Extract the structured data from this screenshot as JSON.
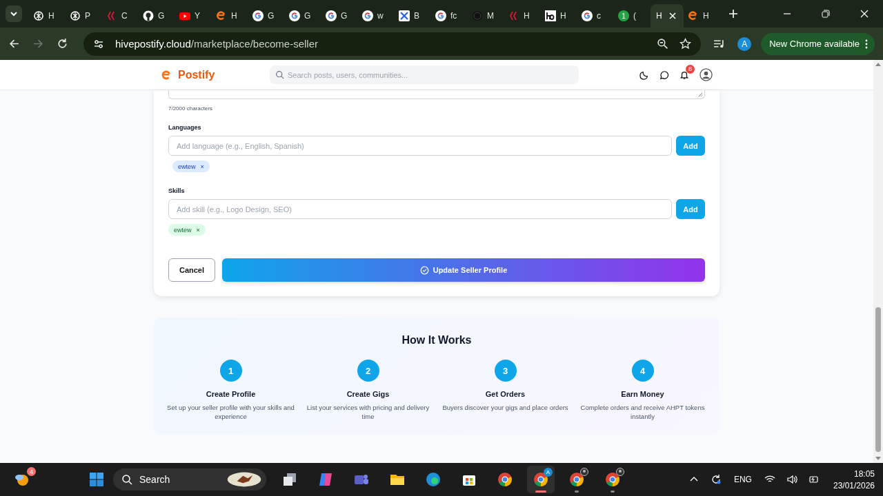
{
  "browser": {
    "tabs": [
      {
        "kind": "chatgpt",
        "label": "H",
        "selected": false
      },
      {
        "kind": "chatgpt",
        "label": "P",
        "selected": false
      },
      {
        "kind": "hive",
        "label": "C",
        "selected": false
      },
      {
        "kind": "github",
        "label": "G",
        "selected": false
      },
      {
        "kind": "youtube",
        "label": "Y",
        "selected": false
      },
      {
        "kind": "postify",
        "label": "H",
        "selected": false
      },
      {
        "kind": "google",
        "label": "G",
        "selected": false
      },
      {
        "kind": "google",
        "label": "G",
        "selected": false
      },
      {
        "kind": "google",
        "label": "G",
        "selected": false
      },
      {
        "kind": "google",
        "label": "w",
        "selected": false
      },
      {
        "kind": "x",
        "label": "B",
        "selected": false
      },
      {
        "kind": "google",
        "label": "fc",
        "selected": false
      },
      {
        "kind": "wordpress",
        "label": "M",
        "selected": false
      },
      {
        "kind": "hive",
        "label": "H",
        "selected": false
      },
      {
        "kind": "ho",
        "label": "H",
        "selected": false
      },
      {
        "kind": "google",
        "label": "c",
        "selected": false
      },
      {
        "kind": "whatsapp",
        "label": "(",
        "badge": "1",
        "selected": false
      },
      {
        "kind": "blank",
        "label": "H",
        "selected": true
      },
      {
        "kind": "postify",
        "label": "H",
        "selected": false
      }
    ],
    "url_host": "hivepostify.cloud",
    "url_path": "/marketplace/become-seller",
    "profile": "A",
    "update": "New Chrome available"
  },
  "app": {
    "logo": "Postify",
    "search": {
      "placeholder": "Search posts, users, communities..."
    },
    "notifications": "8"
  },
  "form": {
    "char_count": "7/2000 characters",
    "sections": [
      {
        "kind": "language",
        "label": "Languages",
        "placeholder": "Add language (e.g., English, Spanish)",
        "button": "Add",
        "tags": [
          {
            "text": "ewtew",
            "remove": "×"
          }
        ]
      },
      {
        "kind": "skill",
        "label": "Skills",
        "placeholder": "Add skill (e.g., Logo Design, SEO)",
        "button": "Add",
        "tags": [
          {
            "text": "ewtew",
            "remove": "×"
          }
        ]
      }
    ],
    "cancel": "Cancel",
    "submit": "Update Seller Profile"
  },
  "how_it_works": {
    "title": "How It Works",
    "steps": [
      {
        "number": "1",
        "title": "Create Profile",
        "description": "Set up your seller profile with your skills and experience"
      },
      {
        "number": "2",
        "title": "Create Gigs",
        "description": "List your services with pricing and delivery time"
      },
      {
        "number": "3",
        "title": "Get Orders",
        "description": "Buyers discover your gigs and place orders"
      },
      {
        "number": "4",
        "title": "Earn Money",
        "description": "Complete orders and receive AHPT tokens instantly"
      }
    ]
  },
  "taskbar": {
    "weather_badge": "4",
    "search": "Search",
    "apps": [
      {
        "kind": "taskview",
        "active": false,
        "running": false
      },
      {
        "kind": "copilot",
        "active": false,
        "running": false
      },
      {
        "kind": "teams",
        "active": false,
        "running": false
      },
      {
        "kind": "explorer",
        "active": false,
        "running": false
      },
      {
        "kind": "edge",
        "active": false,
        "running": false
      },
      {
        "kind": "store",
        "active": false,
        "running": false
      },
      {
        "kind": "chrome",
        "active": false,
        "running": false
      },
      {
        "kind": "chrome",
        "badge": "A",
        "active": true,
        "running": true
      },
      {
        "kind": "chrome-profile",
        "active": false,
        "running": true
      },
      {
        "kind": "chrome-profile",
        "active": false,
        "running": true
      }
    ],
    "language": "ENG",
    "time": "18:05",
    "date": "23/01/2026"
  }
}
